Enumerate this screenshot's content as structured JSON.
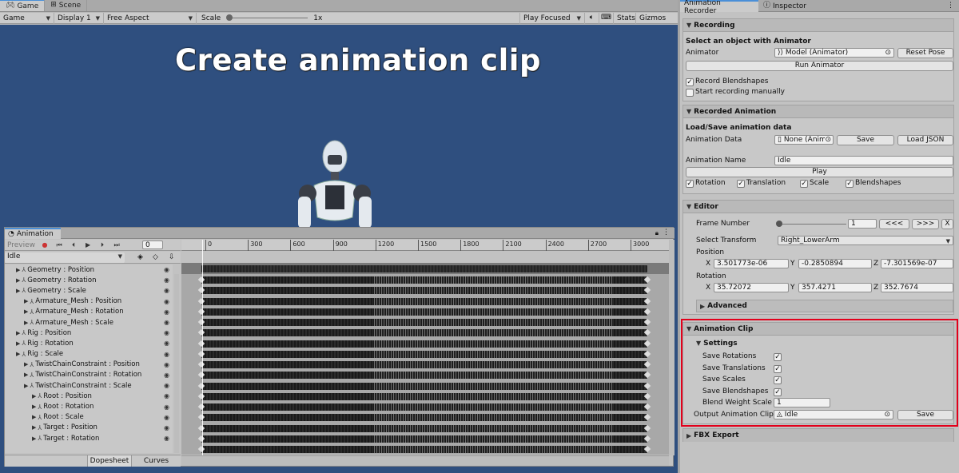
{
  "game": {
    "tabs": [
      {
        "label": "Game"
      },
      {
        "label": "Scene"
      }
    ],
    "toolbar": {
      "mode": "Game",
      "display": "Display 1",
      "aspect": "Free Aspect",
      "scale_label": "Scale",
      "scale_value": "1x",
      "play_focused": "Play Focused",
      "stats": "Stats",
      "gizmos": "Gizmos"
    },
    "title": "Create animation clip"
  },
  "animation": {
    "tab": "Animation",
    "preview": "Preview",
    "frame": "0",
    "clip": "Idle",
    "ticks": [
      "0",
      "300",
      "600",
      "900",
      "1200",
      "1500",
      "1800",
      "2100",
      "2400",
      "2700",
      "3000"
    ],
    "properties": [
      {
        "label": "Geometry : Position",
        "indent": 0
      },
      {
        "label": "Geometry : Rotation",
        "indent": 0
      },
      {
        "label": "Geometry : Scale",
        "indent": 0
      },
      {
        "label": "Armature_Mesh : Position",
        "indent": 1
      },
      {
        "label": "Armature_Mesh : Rotation",
        "indent": 1
      },
      {
        "label": "Armature_Mesh : Scale",
        "indent": 1
      },
      {
        "label": "Rig : Position",
        "indent": 0
      },
      {
        "label": "Rig : Rotation",
        "indent": 0
      },
      {
        "label": "Rig : Scale",
        "indent": 0
      },
      {
        "label": "TwistChainConstraint : Position",
        "indent": 1
      },
      {
        "label": "TwistChainConstraint : Rotation",
        "indent": 1
      },
      {
        "label": "TwistChainConstraint : Scale",
        "indent": 1
      },
      {
        "label": "Root : Position",
        "indent": 2
      },
      {
        "label": "Root : Rotation",
        "indent": 2
      },
      {
        "label": "Root : Scale",
        "indent": 2
      },
      {
        "label": "Target : Position",
        "indent": 2
      },
      {
        "label": "Target : Rotation",
        "indent": 2
      }
    ],
    "bottom_tabs": {
      "dopesheet": "Dopesheet",
      "curves": "Curves"
    }
  },
  "inspector": {
    "tabs": {
      "recorder": "Animation Recorder",
      "inspector": "Inspector"
    },
    "recording": {
      "header": "Recording",
      "select_label": "Select an object with Animator",
      "animator_label": "Animator",
      "animator_value": "Model (Animator)",
      "reset_pose": "Reset Pose",
      "run_animator": "Run Animator",
      "record_blendshapes": "Record Blendshapes",
      "start_manually": "Start recording manually"
    },
    "recorded": {
      "header": "Recorded Animation",
      "load_save_label": "Load/Save animation data",
      "data_label": "Animation Data",
      "data_value": "None (Anima",
      "save": "Save",
      "load_json": "Load JSON",
      "name_label": "Animation Name",
      "name_value": "Idle",
      "play": "Play",
      "rotation": "Rotation",
      "translation": "Translation",
      "scale": "Scale",
      "blendshapes": "Blendshapes"
    },
    "editor": {
      "header": "Editor",
      "frame_label": "Frame Number",
      "frame_value": "1",
      "prev": "<<<",
      "next": ">>>",
      "close": "X",
      "select_transform_label": "Select Transform",
      "select_transform_value": "Right_LowerArm",
      "position_label": "Position",
      "position": {
        "x": "3.501773e-06",
        "y": "-0.2850894",
        "z": "-7.301569e-07"
      },
      "rotation_label": "Rotation",
      "rotation": {
        "x": "35.72072",
        "y": "357.4271",
        "z": "352.7674"
      },
      "advanced": "Advanced",
      "x": "X",
      "y": "Y",
      "z": "Z"
    },
    "clip": {
      "header": "Animation Clip",
      "settings": "Settings",
      "save_rotations": "Save Rotations",
      "save_translations": "Save Translations",
      "save_scales": "Save Scales",
      "save_blendshapes": "Save Blendshapes",
      "blend_weight_label": "Blend Weight Scale",
      "blend_weight_value": "1",
      "output_label": "Output Animation Clip",
      "output_value": "Idle",
      "save": "Save"
    },
    "fbx": {
      "header": "FBX Export"
    }
  },
  "colors": {
    "game_bg": "#2f4f7f",
    "highlight": "#e3001b",
    "tab_accent": "#4a8fd8"
  }
}
